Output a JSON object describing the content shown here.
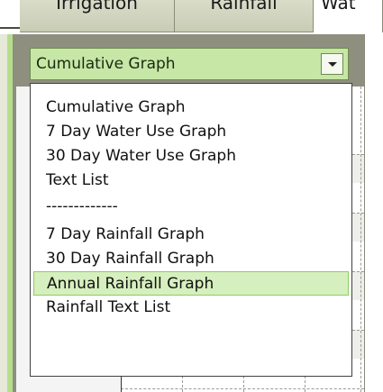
{
  "tabs": [
    {
      "label": "Irrigation",
      "active": false
    },
    {
      "label": "Rainfall",
      "active": false
    },
    {
      "label": "Wat",
      "active": true
    }
  ],
  "combo": {
    "selected": "Cumulative Graph",
    "arrow_icon": "chevron-down-icon"
  },
  "dropdown": {
    "options": [
      "Cumulative Graph",
      "7 Day Water Use Graph",
      "30 Day Water Use Graph",
      "Text List",
      "-------------",
      "7 Day Rainfall Graph",
      "30 Day Rainfall Graph",
      "Annual Rainfall Graph",
      "Rainfall Text List"
    ],
    "highlighted_index": 7
  },
  "colors": {
    "accent_green": "#c6e7a6",
    "highlight_green": "#d6efbe",
    "frame_grey": "#8f8f80"
  }
}
